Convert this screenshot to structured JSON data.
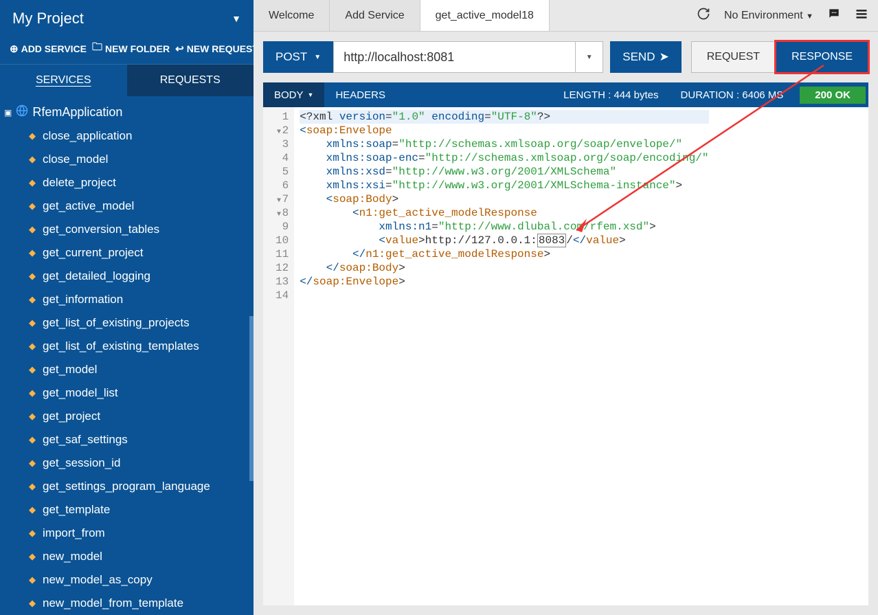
{
  "project": {
    "title": "My Project"
  },
  "sidebar_actions": {
    "add_service": "ADD SERVICE",
    "new_folder": "NEW FOLDER",
    "new_request": "NEW REQUEST"
  },
  "side_tabs": {
    "services": "SERVICES",
    "requests": "REQUESTS"
  },
  "tree_root": "RfemApplication",
  "tree_items": [
    "close_application",
    "close_model",
    "delete_project",
    "get_active_model",
    "get_conversion_tables",
    "get_current_project",
    "get_detailed_logging",
    "get_information",
    "get_list_of_existing_projects",
    "get_list_of_existing_templates",
    "get_model",
    "get_model_list",
    "get_project",
    "get_saf_settings",
    "get_session_id",
    "get_settings_program_language",
    "get_template",
    "import_from",
    "new_model",
    "new_model_as_copy",
    "new_model_from_template"
  ],
  "tabs": {
    "welcome": "Welcome",
    "add_service": "Add Service",
    "active": "get_active_model18"
  },
  "env": {
    "label": "No Environment"
  },
  "request": {
    "method": "POST",
    "url": "http://localhost:8081",
    "send": "SEND"
  },
  "toggle": {
    "request": "REQUEST",
    "response": "RESPONSE"
  },
  "infobar": {
    "body": "BODY",
    "headers": "HEADERS",
    "length": "LENGTH : 444 bytes",
    "duration": "DURATION : 6406 MS",
    "status": "200 OK"
  },
  "code_lines": [
    "<?xml version=\"1.0\" encoding=\"UTF-8\"?>",
    "<soap:Envelope",
    "    xmlns:soap=\"http://schemas.xmlsoap.org/soap/envelope/\"",
    "    xmlns:soap-enc=\"http://schemas.xmlsoap.org/soap/encoding/\"",
    "    xmlns:xsd=\"http://www.w3.org/2001/XMLSchema\"",
    "    xmlns:xsi=\"http://www.w3.org/2001/XMLSchema-instance\">",
    "    <soap:Body>",
    "        <n1:get_active_modelResponse",
    "            xmlns:n1=\"http://www.dlubal.com/rfem.xsd\">",
    "            <value>http://127.0.0.1:8083/</value>",
    "        </n1:get_active_modelResponse>",
    "    </soap:Body>",
    "</soap:Envelope>",
    ""
  ],
  "highlight_port": "8083"
}
